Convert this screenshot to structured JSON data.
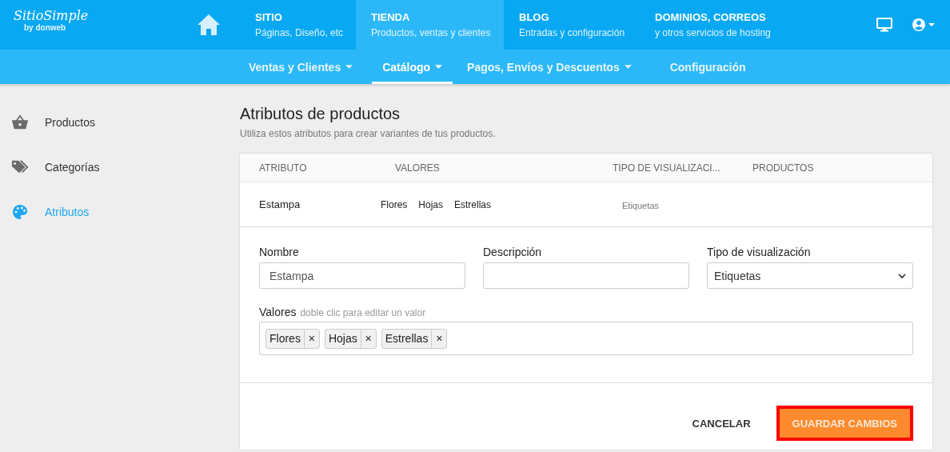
{
  "logo": {
    "name": "SitioSimple",
    "byline": "by donweb"
  },
  "top_tabs": [
    {
      "title": "SITIO",
      "subtitle": "Páginas, Diseño, etc",
      "selected": false
    },
    {
      "title": "TIENDA",
      "subtitle": "Productos, ventas y clientes",
      "selected": true
    },
    {
      "title": "BLOG",
      "subtitle": "Entradas y configuración",
      "selected": false
    },
    {
      "title": "DOMINIOS, CORREOS",
      "subtitle": "y otros servicios de hosting",
      "selected": false
    }
  ],
  "sub_nav": [
    {
      "label": "Ventas y Clientes",
      "dropdown": true,
      "selected": false
    },
    {
      "label": "Catálogo",
      "dropdown": true,
      "selected": true
    },
    {
      "label": "Pagos, Envíos y Descuentos",
      "dropdown": true,
      "selected": false
    },
    {
      "label": "Configuración",
      "dropdown": false,
      "selected": false
    }
  ],
  "sidebar": {
    "items": [
      {
        "label": "Productos",
        "kind": "basket",
        "selected": false
      },
      {
        "label": "Categorías",
        "kind": "tags",
        "selected": false
      },
      {
        "label": "Atributos",
        "kind": "palette",
        "selected": true
      }
    ]
  },
  "page": {
    "title": "Atributos de productos",
    "subtitle": "Utiliza estos atributos para crear variantes de tus productos."
  },
  "table": {
    "columns": [
      "ATRIBUTO",
      "VALORES",
      "TIPO DE VISUALIZACI...",
      "PRODUCTOS"
    ],
    "rows": [
      {
        "name": "Estampa",
        "values": [
          "Flores",
          "Hojas",
          "Estrellas"
        ],
        "display": "Etiquetas"
      }
    ]
  },
  "form": {
    "name": {
      "label": "Nombre",
      "value": "Estampa"
    },
    "description": {
      "label": "Descripción"
    },
    "display_type": {
      "label": "Tipo de visualización",
      "value": "Etiquetas"
    },
    "values": {
      "label": "Valores",
      "hint": "doble clic para editar un valor",
      "tags": [
        "Flores",
        "Hojas",
        "Estrellas"
      ],
      "remove": "×"
    }
  },
  "buttons": [
    {
      "label": "CANCELAR",
      "kind": "flat",
      "highlighted": false
    },
    {
      "label": "GUARDAR CAMBIOS",
      "kind": "primary",
      "highlighted": true
    }
  ]
}
